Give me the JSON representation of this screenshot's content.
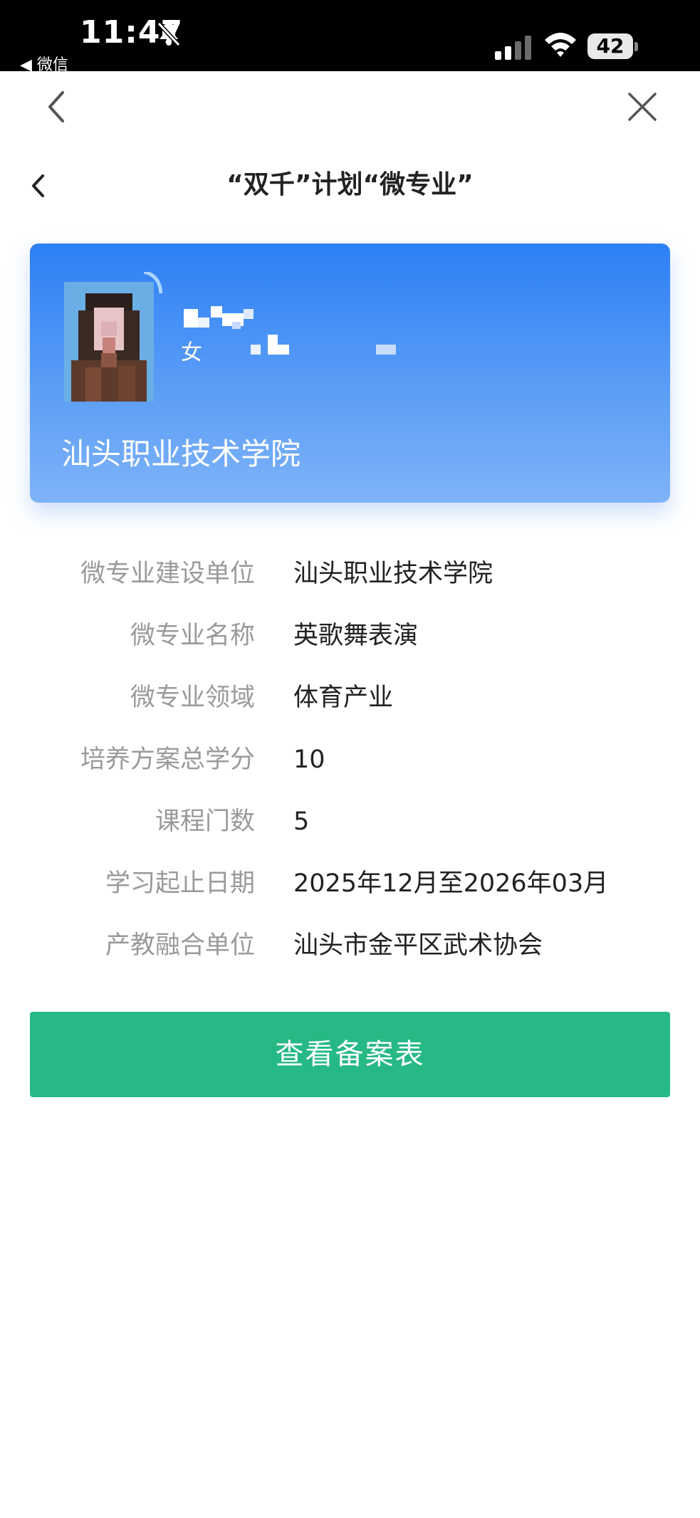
{
  "status_bar": {
    "time": "11:47",
    "back_app": "◀ 微信",
    "battery": "42"
  },
  "header": {
    "title": "“双千”计划“微专业”"
  },
  "profile": {
    "gender": "女",
    "school": "汕头职业技术学院"
  },
  "details": [
    {
      "label": "微专业建设单位",
      "value": "汕头职业技术学院"
    },
    {
      "label": "微专业名称",
      "value": "英歌舞表演"
    },
    {
      "label": "微专业领域",
      "value": "体育产业"
    },
    {
      "label": "培养方案总学分",
      "value": "10"
    },
    {
      "label": "课程门数",
      "value": "5"
    },
    {
      "label": "学习起止日期",
      "value": "2025年12月至2026年03月"
    },
    {
      "label": "产教融合单位",
      "value": "汕头市金平区武术协会"
    }
  ],
  "actions": {
    "view_record": "查看备案表"
  },
  "colors": {
    "card_gradient_top": "#2d7ff5",
    "card_gradient_bottom": "#7fb3f8",
    "button": "#27b985"
  },
  "icons": {
    "status": [
      "bell-off-icon",
      "signal-icon",
      "wifi-icon",
      "battery-icon"
    ],
    "navigation": [
      "chevron-left-icon",
      "close-icon"
    ]
  }
}
